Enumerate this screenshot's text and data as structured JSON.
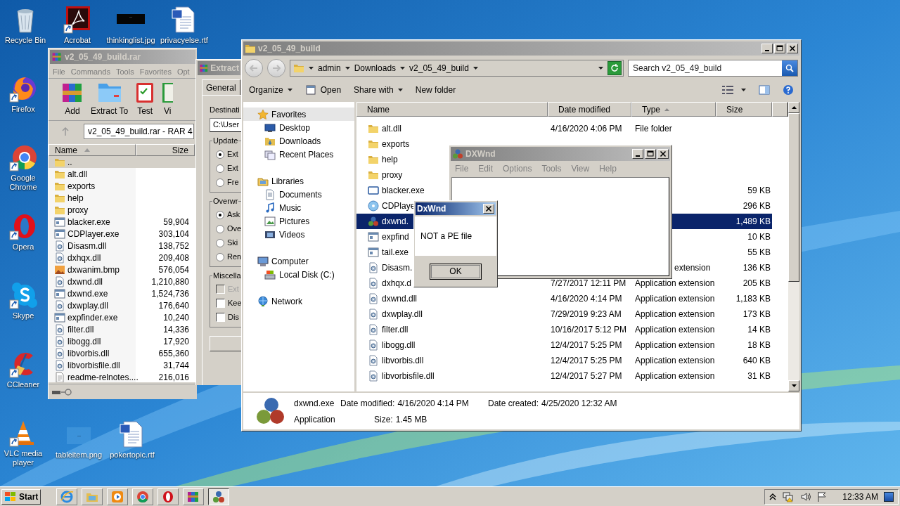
{
  "desktop": {
    "top_row": [
      {
        "label": "Recycle Bin",
        "kind": "recycle",
        "shortcut": false
      },
      {
        "label": "Acrobat",
        "kind": "acrobat",
        "shortcut": true
      },
      {
        "label": "thinkinglist.jpg",
        "kind": "dark-image",
        "shortcut": false
      },
      {
        "label": "privacyelse.rtf",
        "kind": "word",
        "shortcut": false
      }
    ],
    "left_column": [
      {
        "label": "Firefox",
        "kind": "firefox",
        "shortcut": true
      },
      {
        "label": "Google Chrome",
        "kind": "chrome",
        "shortcut": true
      },
      {
        "label": "Opera",
        "kind": "opera",
        "shortcut": true
      },
      {
        "label": "Skype",
        "kind": "skype",
        "shortcut": true
      },
      {
        "label": "CCleaner",
        "kind": "ccleaner",
        "shortcut": true
      },
      {
        "label": "VLC media player",
        "kind": "vlc",
        "shortcut": true
      }
    ],
    "bottom_row": [
      {
        "label": "tableitem.png",
        "kind": "blank-image",
        "shortcut": false
      },
      {
        "label": "pokertopic.rtf",
        "kind": "word",
        "shortcut": false
      }
    ]
  },
  "winrar": {
    "title": "v2_05_49_build.rar",
    "menu": [
      "File",
      "Commands",
      "Tools",
      "Favorites",
      "Opt"
    ],
    "toolbar": [
      {
        "label": "Add",
        "kind": "add"
      },
      {
        "label": "Extract To",
        "kind": "extract"
      },
      {
        "label": "Test",
        "kind": "test"
      },
      {
        "label": "Vi",
        "kind": "view"
      }
    ],
    "path": "v2_05_49_build.rar - RAR 4",
    "columns": [
      {
        "label": "Name",
        "sorted": true
      },
      {
        "label": "Size",
        "sorted": false
      }
    ],
    "rows": [
      {
        "name": "..",
        "kind": "folder",
        "selected": true
      },
      {
        "name": "alt.dll",
        "kind": "folder",
        "selected": false
      },
      {
        "name": "exports",
        "kind": "folder",
        "selected": false
      },
      {
        "name": "help",
        "kind": "folder",
        "selected": false
      },
      {
        "name": "proxy",
        "kind": "folder",
        "selected": false
      },
      {
        "name": "blacker.exe",
        "kind": "exe",
        "size": "59,904",
        "selected": false
      },
      {
        "name": "CDPlayer.exe",
        "kind": "exe",
        "size": "303,104",
        "selected": false
      },
      {
        "name": "Disasm.dll",
        "kind": "dll",
        "size": "138,752",
        "selected": false
      },
      {
        "name": "dxhqx.dll",
        "kind": "dll",
        "size": "209,408",
        "selected": false
      },
      {
        "name": "dxwanim.bmp",
        "kind": "bmp",
        "size": "576,054",
        "selected": false
      },
      {
        "name": "dxwnd.dll",
        "kind": "dll",
        "size": "1,210,880",
        "selected": false
      },
      {
        "name": "dxwnd.exe",
        "kind": "exe",
        "size": "1,524,736",
        "selected": false
      },
      {
        "name": "dxwplay.dll",
        "kind": "dll",
        "size": "176,640",
        "selected": false
      },
      {
        "name": "expfinder.exe",
        "kind": "exe",
        "size": "10,240",
        "selected": false
      },
      {
        "name": "filter.dll",
        "kind": "dll",
        "size": "14,336",
        "selected": false
      },
      {
        "name": "libogg.dll",
        "kind": "dll",
        "size": "17,920",
        "selected": false
      },
      {
        "name": "libvorbis.dll",
        "kind": "dll",
        "size": "655,360",
        "selected": false
      },
      {
        "name": "libvorbisfile.dll",
        "kind": "dll",
        "size": "31,744",
        "selected": false
      },
      {
        "name": "readme-relnotes....",
        "kind": "txt",
        "size": "216,016",
        "selected": false
      }
    ]
  },
  "extract_dialog": {
    "title": "Extract",
    "tabs": [
      {
        "label": "General",
        "selected": true
      }
    ],
    "destination_label": "Destinati",
    "destination_value": "C:\\User",
    "groups": [
      {
        "title": "Update",
        "options": [
          {
            "label": "Ext",
            "kind": "radio",
            "checked": true,
            "disabled": false
          },
          {
            "label": "Ext",
            "kind": "radio",
            "checked": false,
            "disabled": false
          },
          {
            "label": "Fre",
            "kind": "radio",
            "checked": false,
            "disabled": false
          }
        ]
      },
      {
        "title": "Overwr",
        "options": [
          {
            "label": "Ask",
            "kind": "radio",
            "checked": true,
            "disabled": false
          },
          {
            "label": "Ove",
            "kind": "radio",
            "checked": false,
            "disabled": false
          },
          {
            "label": "Ski",
            "kind": "radio",
            "checked": false,
            "disabled": false
          },
          {
            "label": "Ren",
            "kind": "radio",
            "checked": false,
            "disabled": false
          }
        ]
      },
      {
        "title": "Miscella",
        "options": [
          {
            "label": "Ext",
            "kind": "checkbox",
            "checked": false,
            "disabled": true
          },
          {
            "label": "Kee",
            "kind": "checkbox",
            "checked": false,
            "disabled": false
          },
          {
            "label": "Dis",
            "kind": "checkbox",
            "checked": false,
            "disabled": false
          }
        ]
      }
    ]
  },
  "explorer": {
    "title": "v2_05_49_build",
    "breadcrumbs": [
      "admin",
      "Downloads",
      "v2_05_49_build"
    ],
    "search_placeholder": "Search v2_05_49_build",
    "toolbar": [
      {
        "label": "Organize",
        "kind": "menu"
      },
      {
        "label": "Open",
        "kind": "open"
      },
      {
        "label": "Share with",
        "kind": "menu"
      },
      {
        "label": "New folder",
        "kind": "plain"
      }
    ],
    "nav": [
      {
        "label": "Favorites",
        "kind": "star",
        "selected": true,
        "children": [
          {
            "label": "Desktop",
            "kind": "desktop",
            "selected": false
          },
          {
            "label": "Downloads",
            "kind": "downloads",
            "selected": false
          },
          {
            "label": "Recent Places",
            "kind": "recent",
            "selected": false
          }
        ]
      },
      {
        "label": "Libraries",
        "kind": "library",
        "selected": false,
        "children": [
          {
            "label": "Documents",
            "kind": "documents",
            "selected": false
          },
          {
            "label": "Music",
            "kind": "music",
            "selected": false
          },
          {
            "label": "Pictures",
            "kind": "pictures",
            "selected": false
          },
          {
            "label": "Videos",
            "kind": "videos",
            "selected": false
          }
        ]
      },
      {
        "label": "Computer",
        "kind": "computer",
        "selected": false,
        "children": [
          {
            "label": "Local Disk (C:)",
            "kind": "disk",
            "selected": false
          }
        ]
      },
      {
        "label": "Network",
        "kind": "network",
        "selected": false
      }
    ],
    "columns": [
      {
        "label": "Name",
        "sorted": false
      },
      {
        "label": "Date modified",
        "sorted": false
      },
      {
        "label": "Type",
        "sorted": true
      },
      {
        "label": "Size",
        "sorted": false
      }
    ],
    "rows": [
      {
        "name": "alt.dll",
        "kind": "folder",
        "date": "4/16/2020 4:06 PM",
        "type": "File folder",
        "selected": false
      },
      {
        "name": "exports",
        "kind": "folder",
        "selected": false
      },
      {
        "name": "help",
        "kind": "folder",
        "selected": false
      },
      {
        "name": "proxy",
        "kind": "folder",
        "selected": false
      },
      {
        "name": "blacker.exe",
        "kind": "window",
        "size": "59 KB",
        "selected": false
      },
      {
        "name": "CDPlaye",
        "kind": "disc",
        "size": "296 KB",
        "selected": false
      },
      {
        "name": "dxwnd.",
        "kind": "dxwnd",
        "size": "1,489 KB",
        "selected": true
      },
      {
        "name": "expfind",
        "kind": "exe",
        "size": "10 KB",
        "selected": false
      },
      {
        "name": "tail.exe",
        "kind": "exe",
        "size": "55 KB",
        "selected": false
      },
      {
        "name": "Disasm.",
        "kind": "dll",
        "type_tail": "extension",
        "size": "136 KB",
        "selected": false
      },
      {
        "name": "dxhqx.d",
        "kind": "dll",
        "date": "7/27/2017 12:11 PM",
        "type": "Application extension",
        "size": "205 KB",
        "selected": false
      },
      {
        "name": "dxwnd.dll",
        "kind": "dll",
        "date": "4/16/2020 4:14 PM",
        "type": "Application extension",
        "size": "1,183 KB",
        "selected": false
      },
      {
        "name": "dxwplay.dll",
        "kind": "dll",
        "date": "7/29/2019 9:23 AM",
        "type": "Application extension",
        "size": "173 KB",
        "selected": false
      },
      {
        "name": "filter.dll",
        "kind": "dll",
        "date": "10/16/2017 5:12 PM",
        "type": "Application extension",
        "size": "14 KB",
        "selected": false
      },
      {
        "name": "libogg.dll",
        "kind": "dll",
        "date": "12/4/2017 5:25 PM",
        "type": "Application extension",
        "size": "18 KB",
        "selected": false
      },
      {
        "name": "libvorbis.dll",
        "kind": "dll",
        "date": "12/4/2017 5:25 PM",
        "type": "Application extension",
        "size": "640 KB",
        "selected": false
      },
      {
        "name": "libvorbisfile.dll",
        "kind": "dll",
        "date": "12/4/2017 5:27 PM",
        "type": "Application extension",
        "size": "31 KB",
        "selected": false
      }
    ],
    "details": {
      "name": "dxwnd.exe",
      "kind_label": "Application",
      "fields": [
        {
          "label": "Date modified:",
          "value": "4/16/2020 4:14 PM"
        },
        {
          "label": "Date created:",
          "value": "4/25/2020 12:32 AM"
        },
        {
          "label": "Size:",
          "value": "1.45 MB"
        }
      ]
    }
  },
  "dxwnd_window": {
    "title": "DXWnd",
    "menu": [
      "File",
      "Edit",
      "Options",
      "Tools",
      "View",
      "Help"
    ]
  },
  "message_box": {
    "title": "DxWnd",
    "message": "NOT a PE file",
    "button": "OK"
  },
  "taskbar": {
    "start": "Start",
    "apps": [
      {
        "kind": "ie",
        "active": false
      },
      {
        "kind": "explorer",
        "active": false
      },
      {
        "kind": "media",
        "active": false
      },
      {
        "kind": "chrome",
        "active": false
      },
      {
        "kind": "opera",
        "active": false
      },
      {
        "kind": "winrar",
        "active": false
      },
      {
        "kind": "dxwnd",
        "active": true
      }
    ],
    "clock": "12:33 AM"
  }
}
